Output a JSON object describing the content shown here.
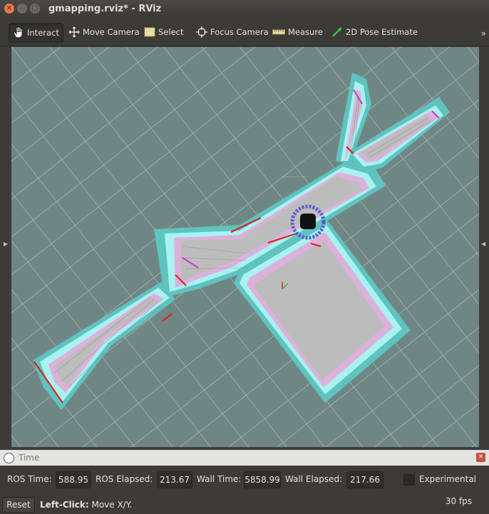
{
  "window": {
    "title": "gmapping.rviz* - RViz",
    "close": "×",
    "minimize": "–",
    "maximize": "□"
  },
  "toolbar": {
    "tools": [
      {
        "label": "Interact",
        "icon": "hand-icon"
      },
      {
        "label": "Move Camera",
        "icon": "move-arrows-icon"
      },
      {
        "label": "Select",
        "icon": "select-box-icon"
      },
      {
        "label": "Focus Camera",
        "icon": "crosshair-icon"
      },
      {
        "label": "Measure",
        "icon": "ruler-icon"
      },
      {
        "label": "2D Pose Estimate",
        "icon": "pose-arrow-icon"
      }
    ],
    "overflow": "»"
  },
  "viewport": {
    "background": "#6f8784",
    "map_free": "#b8b8b8",
    "map_inflation": "#5fc3c0",
    "map_costmap": "#e5a6d8",
    "wall": "#e02020"
  },
  "time_panel": {
    "title": "Time",
    "ros_time_label": "ROS Time:",
    "ros_time": "588.95",
    "ros_elapsed_label": "ROS Elapsed:",
    "ros_elapsed": "213.67",
    "wall_time_label": "Wall Time:",
    "wall_time": "5858.99",
    "wall_elapsed_label": "Wall Elapsed:",
    "wall_elapsed": "217.66",
    "experimental_label": "Experimental",
    "experimental_checked": false
  },
  "status_bar": {
    "reset_label": "Reset",
    "hint_key": "Left-Click:",
    "hint_text": " Move X/Y.",
    "fps": "30 fps"
  }
}
